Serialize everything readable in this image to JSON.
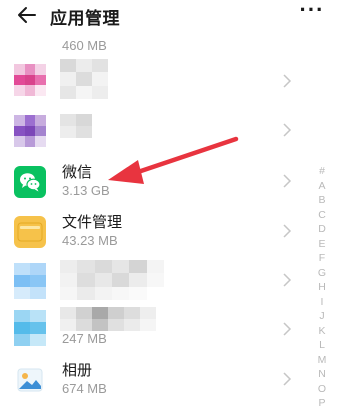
{
  "header": {
    "title": "应用管理",
    "more_glyph": "···"
  },
  "list": {
    "partial_size_text": "460 MB",
    "apps": [
      {
        "id": "blurred-app-1",
        "name": "",
        "size": ""
      },
      {
        "id": "blurred-app-2",
        "name": "",
        "size": ""
      },
      {
        "id": "wechat",
        "name": "微信",
        "size": "3.13 GB"
      },
      {
        "id": "file-manager",
        "name": "文件管理",
        "size": "43.23 MB"
      },
      {
        "id": "blurred-app-3",
        "name": "",
        "size": ""
      },
      {
        "id": "blurred-app-4",
        "name": "",
        "size": "247 MB"
      },
      {
        "id": "gallery",
        "name": "相册",
        "size": "674 MB"
      }
    ]
  },
  "index_letters": [
    "#",
    "A",
    "B",
    "C",
    "D",
    "E",
    "F",
    "G",
    "H",
    "I",
    "J",
    "K",
    "L",
    "M",
    "N",
    "O",
    "P"
  ],
  "icons": {
    "back": "arrow-left-icon",
    "more": "more-dots-icon",
    "chevron": "chevron-right-icon",
    "wechat": "wechat-icon",
    "file_manager": "folder-icon",
    "gallery": "photo-icon"
  },
  "colors": {
    "accent_red": "#e8343f",
    "wechat_green": "#09c160",
    "folder_yellow": "#f6c24a"
  }
}
